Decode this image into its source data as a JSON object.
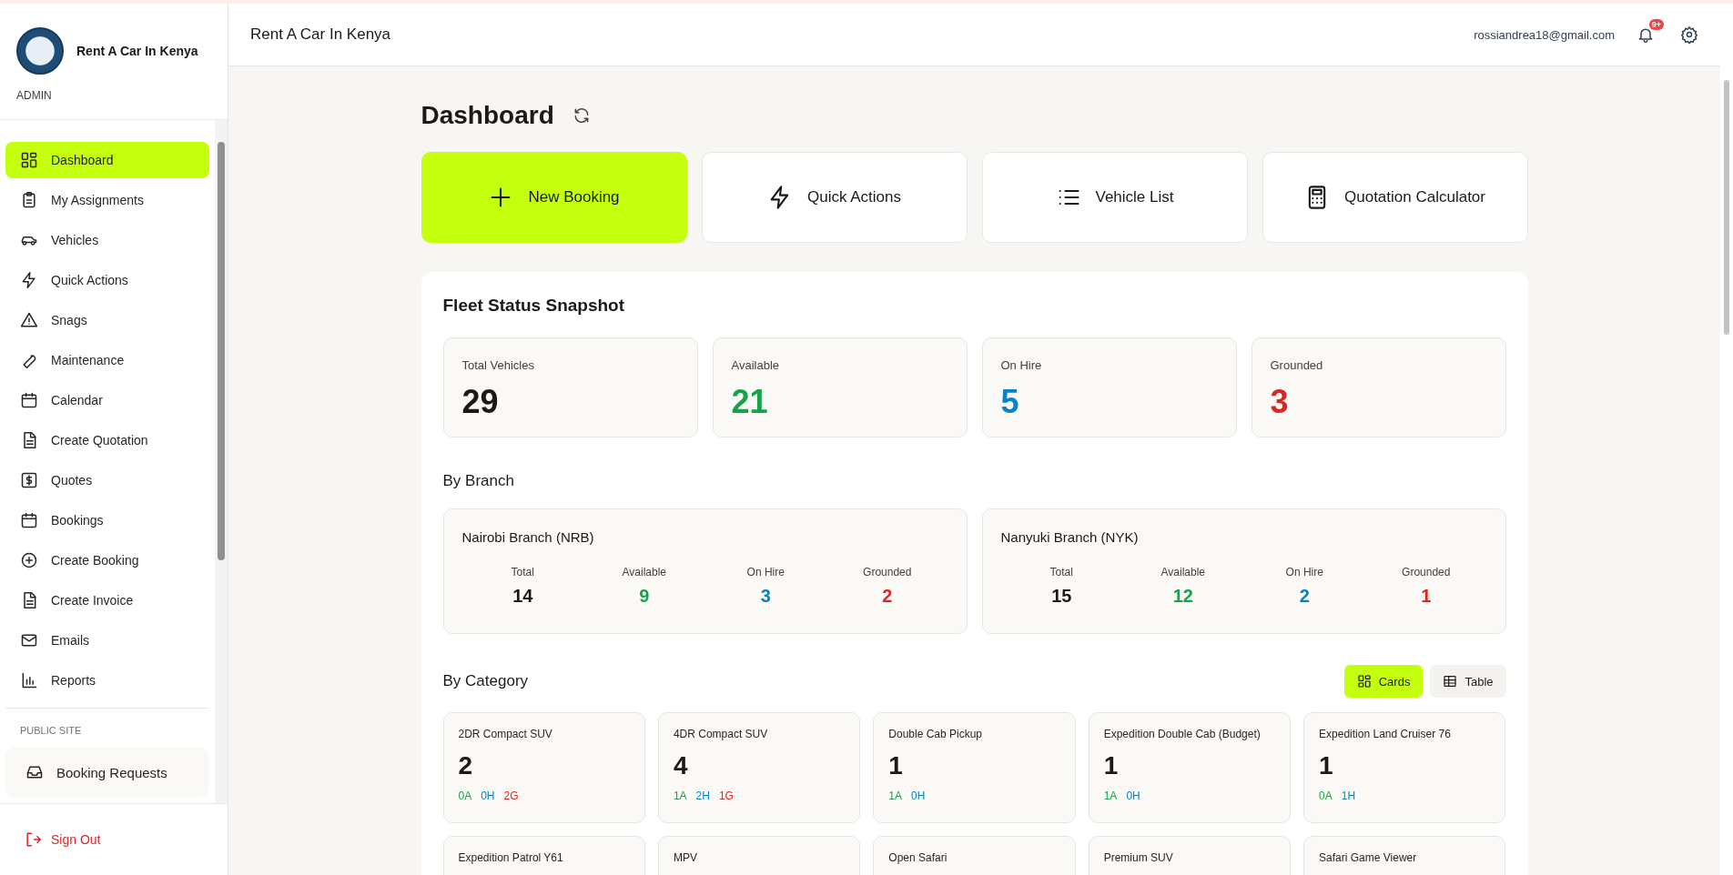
{
  "brand": {
    "name": "Rent A Car In Kenya",
    "role": "ADMIN"
  },
  "nav": [
    {
      "label": "Dashboard",
      "selected": true
    },
    {
      "label": "My Assignments",
      "selected": false
    },
    {
      "label": "Vehicles",
      "selected": false
    },
    {
      "label": "Quick Actions",
      "selected": false
    },
    {
      "label": "Snags",
      "selected": false
    },
    {
      "label": "Maintenance",
      "selected": false
    },
    {
      "label": "Calendar",
      "selected": false
    },
    {
      "label": "Create Quotation",
      "selected": false
    },
    {
      "label": "Quotes",
      "selected": false
    },
    {
      "label": "Bookings",
      "selected": false
    },
    {
      "label": "Create Booking",
      "selected": false
    },
    {
      "label": "Create Invoice",
      "selected": false
    },
    {
      "label": "Emails",
      "selected": false
    },
    {
      "label": "Reports",
      "selected": false
    }
  ],
  "public_site": {
    "heading": "PUBLIC SITE",
    "items": [
      {
        "label": "Booking Requests",
        "selected": false
      }
    ]
  },
  "sign_out": "Sign Out",
  "header": {
    "title": "Rent A Car In Kenya",
    "email": "rossiandrea18@gmail.com",
    "notifications": "9+"
  },
  "page_title": "Dashboard",
  "actions": [
    {
      "label": "New Booking",
      "primary": true
    },
    {
      "label": "Quick Actions",
      "primary": false
    },
    {
      "label": "Vehicle List",
      "primary": false
    },
    {
      "label": "Quotation Calculator",
      "primary": false
    }
  ],
  "fleet": {
    "title": "Fleet Status Snapshot",
    "stats": [
      {
        "label": "Total Vehicles",
        "value": "29",
        "kind": "total"
      },
      {
        "label": "Available",
        "value": "21",
        "kind": "available"
      },
      {
        "label": "On Hire",
        "value": "5",
        "kind": "hire"
      },
      {
        "label": "Grounded",
        "value": "3",
        "kind": "grounded"
      }
    ],
    "branch_heading": "By Branch",
    "branches": [
      {
        "name": "Nairobi Branch (NRB)",
        "stats": [
          {
            "label": "Total",
            "value": "14",
            "kind": "total"
          },
          {
            "label": "Available",
            "value": "9",
            "kind": "available"
          },
          {
            "label": "On Hire",
            "value": "3",
            "kind": "hire"
          },
          {
            "label": "Grounded",
            "value": "2",
            "kind": "grounded"
          }
        ]
      },
      {
        "name": "Nanyuki Branch (NYK)",
        "stats": [
          {
            "label": "Total",
            "value": "15",
            "kind": "total"
          },
          {
            "label": "Available",
            "value": "12",
            "kind": "available"
          },
          {
            "label": "On Hire",
            "value": "2",
            "kind": "hire"
          },
          {
            "label": "Grounded",
            "value": "1",
            "kind": "grounded"
          }
        ]
      }
    ],
    "category_heading": "By Category",
    "views": [
      {
        "label": "Cards",
        "selected": true
      },
      {
        "label": "Table",
        "selected": false
      }
    ],
    "categories": [
      {
        "name": "2DR Compact SUV",
        "count": "2",
        "stats": [
          {
            "text": "0A",
            "kind": "available"
          },
          {
            "text": "0H",
            "kind": "hire"
          },
          {
            "text": "2G",
            "kind": "grounded"
          }
        ]
      },
      {
        "name": "4DR Compact SUV",
        "count": "4",
        "stats": [
          {
            "text": "1A",
            "kind": "available"
          },
          {
            "text": "2H",
            "kind": "hire"
          },
          {
            "text": "1G",
            "kind": "grounded"
          }
        ]
      },
      {
        "name": "Double Cab Pickup",
        "count": "1",
        "stats": [
          {
            "text": "1A",
            "kind": "available"
          },
          {
            "text": "0H",
            "kind": "hire"
          }
        ]
      },
      {
        "name": "Expedition Double Cab (Budget)",
        "count": "1",
        "stats": [
          {
            "text": "1A",
            "kind": "available"
          },
          {
            "text": "0H",
            "kind": "hire"
          }
        ]
      },
      {
        "name": "Expedition Land Cruiser 76",
        "count": "1",
        "stats": [
          {
            "text": "0A",
            "kind": "available"
          },
          {
            "text": "1H",
            "kind": "hire"
          }
        ]
      },
      {
        "name": "Expedition Patrol Y61"
      },
      {
        "name": "MPV"
      },
      {
        "name": "Open Safari"
      },
      {
        "name": "Premium SUV"
      },
      {
        "name": "Safari Game Viewer"
      }
    ]
  }
}
